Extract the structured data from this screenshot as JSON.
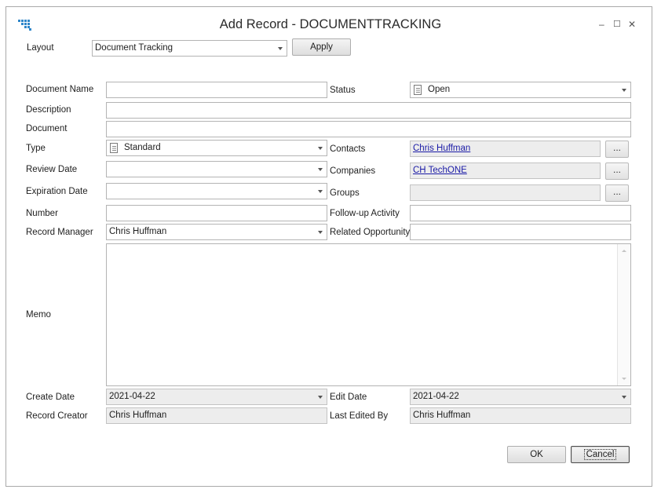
{
  "window": {
    "title": "Add Record - DOCUMENTTRACKING",
    "controls": {
      "minimize": "–",
      "maximize": "☐",
      "close": "✕"
    },
    "accent_color": "#2f86c9"
  },
  "layout_row": {
    "label": "Layout",
    "value": "Document Tracking",
    "apply_label": "Apply"
  },
  "form": {
    "document_name": {
      "label": "Document Name",
      "value": ""
    },
    "status": {
      "label": "Status",
      "value": "Open",
      "icon": "document-icon"
    },
    "description": {
      "label": "Description",
      "value": ""
    },
    "document": {
      "label": "Document",
      "value": ""
    },
    "type": {
      "label": "Type",
      "value": "Standard",
      "icon": "document-icon"
    },
    "contacts": {
      "label": "Contacts",
      "value": "Chris Huffman",
      "browse": "..."
    },
    "review_date": {
      "label": "Review Date",
      "value": ""
    },
    "companies": {
      "label": "Companies",
      "value": "CH TechONE",
      "browse": "..."
    },
    "expiration_date": {
      "label": "Expiration Date",
      "value": ""
    },
    "groups": {
      "label": "Groups",
      "value": "",
      "browse": "..."
    },
    "number": {
      "label": "Number",
      "value": ""
    },
    "followup_activity": {
      "label": "Follow-up Activity",
      "value": ""
    },
    "record_manager": {
      "label": "Record Manager",
      "value": "Chris Huffman"
    },
    "related_opportunity": {
      "label": "Related Opportunity",
      "value": ""
    },
    "memo": {
      "label": "Memo",
      "value": ""
    },
    "create_date": {
      "label": "Create Date",
      "value": "2021-04-22"
    },
    "edit_date": {
      "label": "Edit Date",
      "value": "2021-04-22"
    },
    "record_creator": {
      "label": "Record Creator",
      "value": "Chris Huffman"
    },
    "last_edited_by": {
      "label": "Last Edited By",
      "value": "Chris Huffman"
    }
  },
  "buttons": {
    "ok": "OK",
    "cancel": "Cancel"
  }
}
